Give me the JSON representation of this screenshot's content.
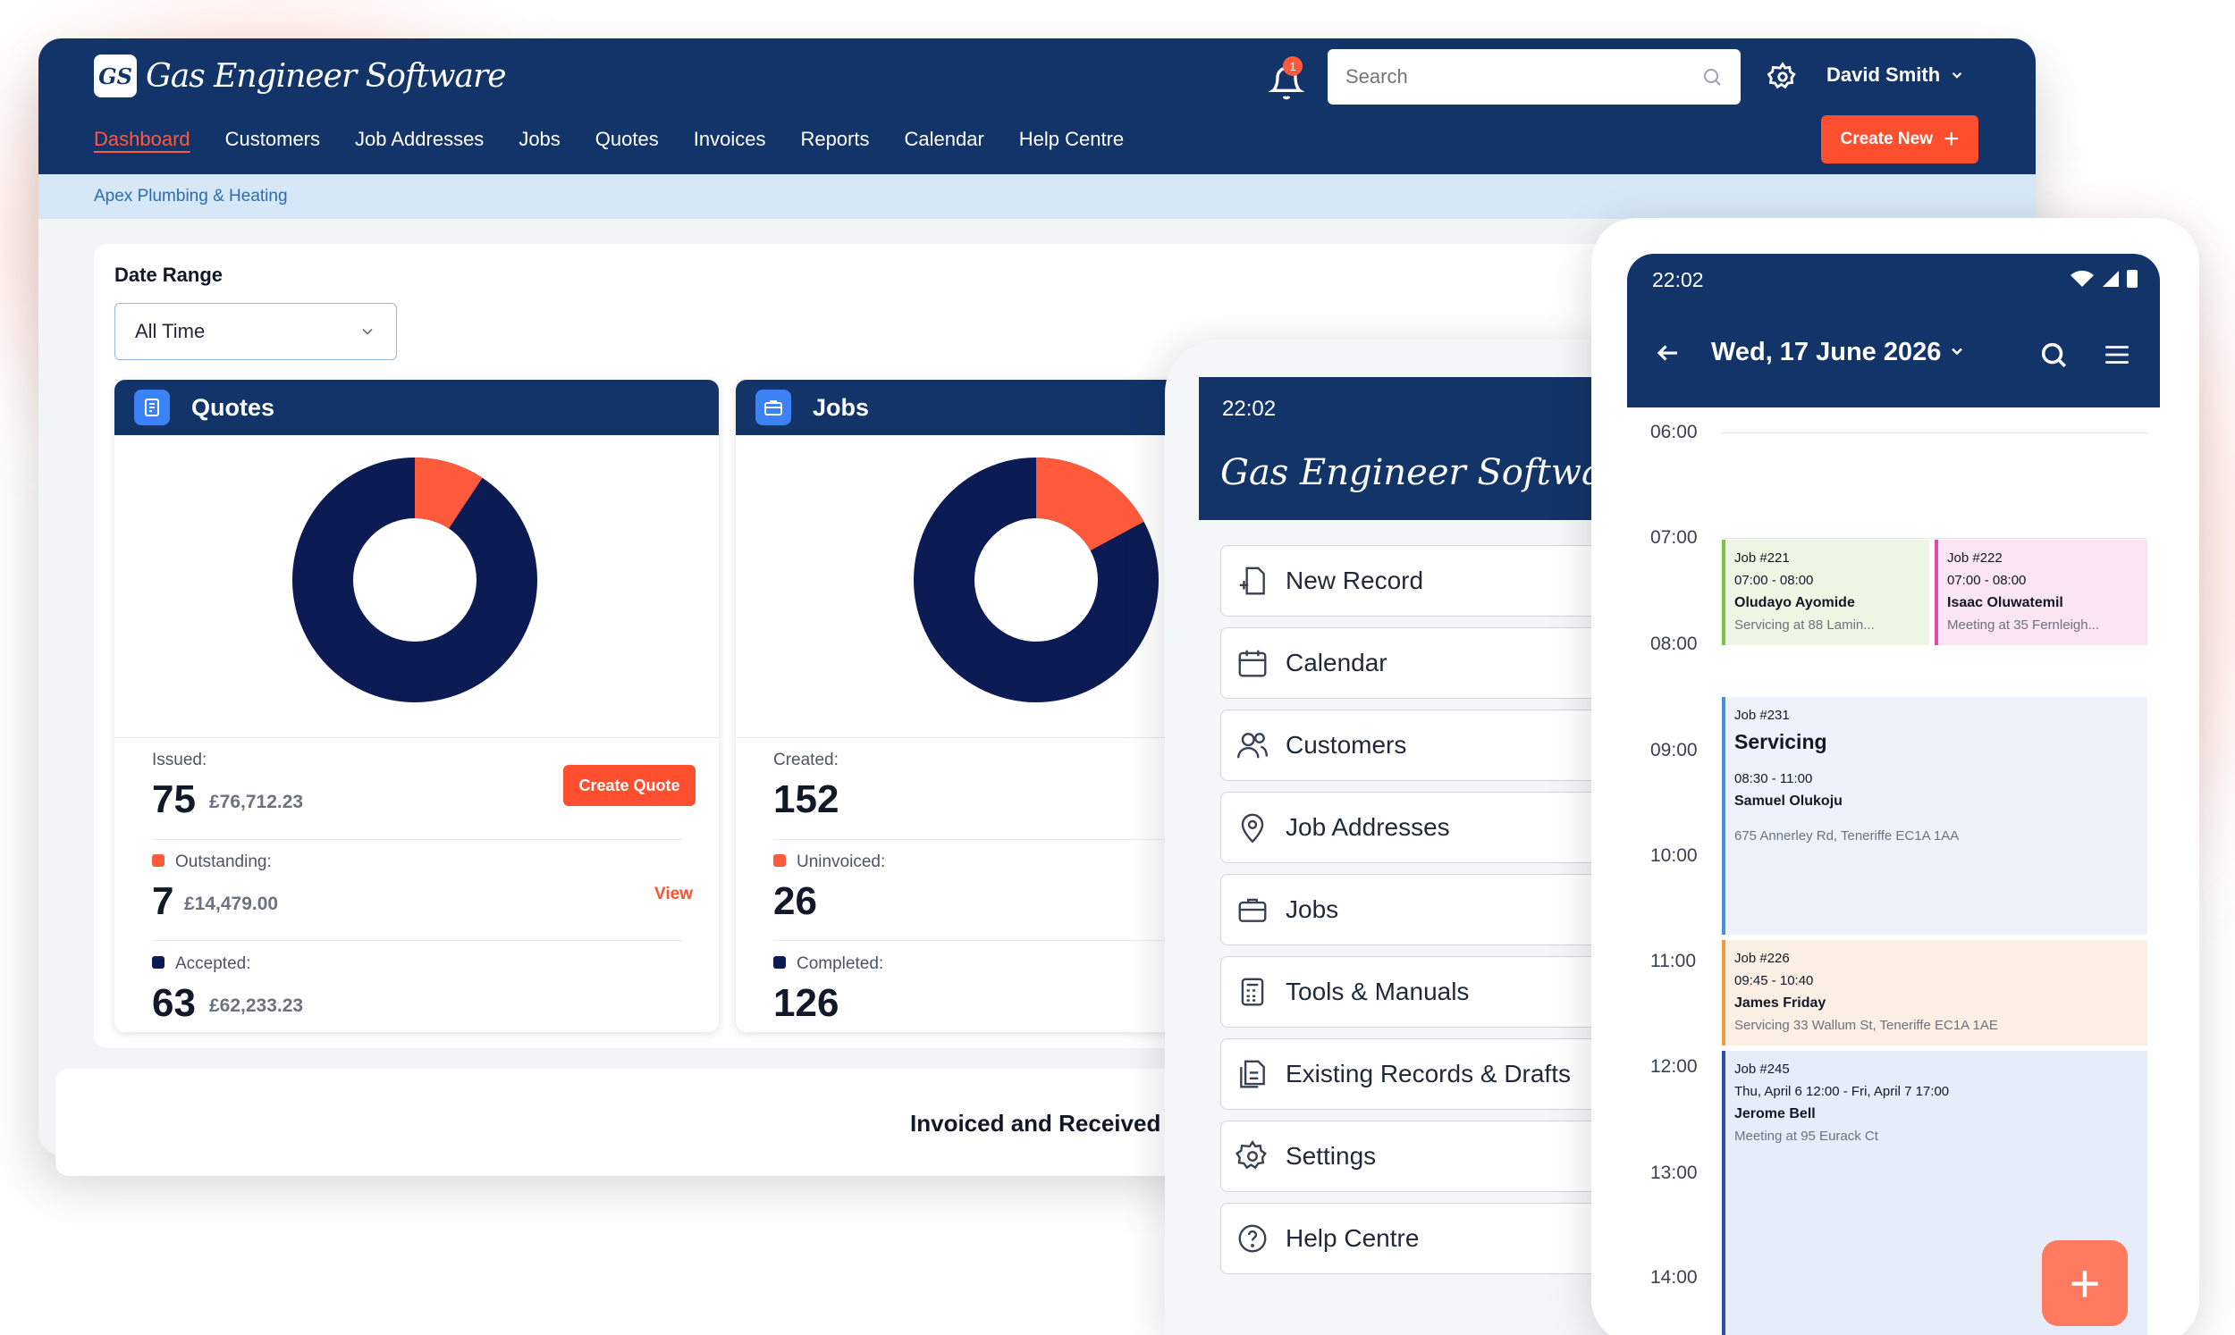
{
  "app": {
    "logo_mark": "GS",
    "logo_text": "Gas Engineer Software"
  },
  "nav": {
    "items": [
      "Dashboard",
      "Customers",
      "Job Addresses",
      "Jobs",
      "Quotes",
      "Invoices",
      "Reports",
      "Calendar",
      "Help Centre"
    ]
  },
  "header": {
    "notification_count": "1",
    "search_placeholder": "Search",
    "user_name": "David Smith",
    "create_new": "Create New"
  },
  "breadcrumb": "Apex Plumbing & Heating",
  "date_range": {
    "label": "Date Range",
    "value": "All Time"
  },
  "quotes": {
    "title": "Quotes",
    "issued_label": "Issued:",
    "issued_count": "75",
    "issued_amount": "£76,712.23",
    "outstanding_label": "Outstanding:",
    "outstanding_count": "7",
    "outstanding_amount": "£14,479.00",
    "accepted_label": "Accepted:",
    "accepted_count": "63",
    "accepted_amount": "£62,233.23",
    "create_button": "Create Quote",
    "view_link": "View",
    "outstanding_fraction": 0.093
  },
  "jobs": {
    "title": "Jobs",
    "created_label": "Created:",
    "created_count": "152",
    "uninvoiced_label": "Uninvoiced:",
    "uninvoiced_count": "26",
    "completed_label": "Completed:",
    "completed_count": "126",
    "uninvoiced_fraction": 0.171
  },
  "invoiced_title": "Invoiced and Received",
  "colors": {
    "navy": "#123468",
    "accent": "#ff4f2e",
    "donut_dark": "#0d1b55"
  },
  "menu_phone": {
    "time": "22:02",
    "logo": "Gas Engineer Software",
    "items": [
      {
        "label": "New Record",
        "icon": "new-record-icon"
      },
      {
        "label": "Calendar",
        "icon": "calendar-icon"
      },
      {
        "label": "Customers",
        "icon": "customers-icon"
      },
      {
        "label": "Job Addresses",
        "icon": "location-pin-icon"
      },
      {
        "label": "Jobs",
        "icon": "briefcase-icon"
      },
      {
        "label": "Tools & Manuals",
        "icon": "calculator-icon"
      },
      {
        "label": "Existing Records & Drafts",
        "icon": "documents-icon"
      },
      {
        "label": "Settings",
        "icon": "gear-icon"
      },
      {
        "label": "Help Centre",
        "icon": "help-icon"
      }
    ]
  },
  "calendar_phone": {
    "time": "22:02",
    "date": "Wed, 17 June 2026",
    "hours": [
      "06:00",
      "07:00",
      "08:00",
      "09:00",
      "10:00",
      "11:00",
      "12:00",
      "13:00",
      "14:00"
    ],
    "events": [
      {
        "job": "Job #221",
        "time": "07:00 - 08:00",
        "name": "Oludayo Ayomide",
        "desc": "Servicing at 88 Lamin..."
      },
      {
        "job": "Job #222",
        "time": "07:00 - 08:00",
        "name": "Isaac Oluwatemil",
        "desc": "Meeting at 35 Fernleigh..."
      },
      {
        "job": "Job #231",
        "title": "Servicing",
        "time": "08:30 - 11:00",
        "name": "Samuel Olukoju",
        "desc": "675 Annerley Rd, Teneriffe EC1A 1AA"
      },
      {
        "job": "Job #226",
        "time": "09:45 - 10:40",
        "name": "James Friday",
        "desc": "Servicing 33 Wallum St, Teneriffe EC1A 1AE"
      },
      {
        "job": "Job #245",
        "time": "Thu, April 6 12:00 -  Fri, April 7 17:00",
        "name": "Jerome Bell",
        "desc": "Meeting at 95 Eurack Ct"
      }
    ]
  }
}
